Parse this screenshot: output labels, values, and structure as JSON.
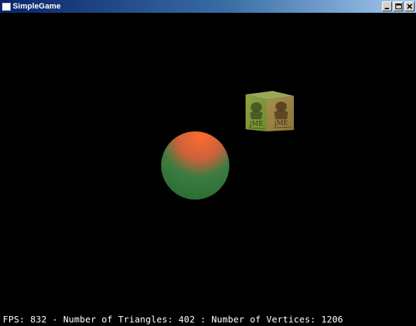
{
  "window": {
    "title": "SimpleGame"
  },
  "scene": {
    "background_color": "#000000",
    "objects": [
      {
        "name": "sphere",
        "top_color": "#ff6a2e",
        "bottom_color": "#2f7a3c"
      },
      {
        "name": "textured-box",
        "texture_text": "jME"
      }
    ]
  },
  "hud": {
    "stats_text": "FPS: 832 - Number of Triangles: 402 : Number of Vertices: 1206"
  }
}
